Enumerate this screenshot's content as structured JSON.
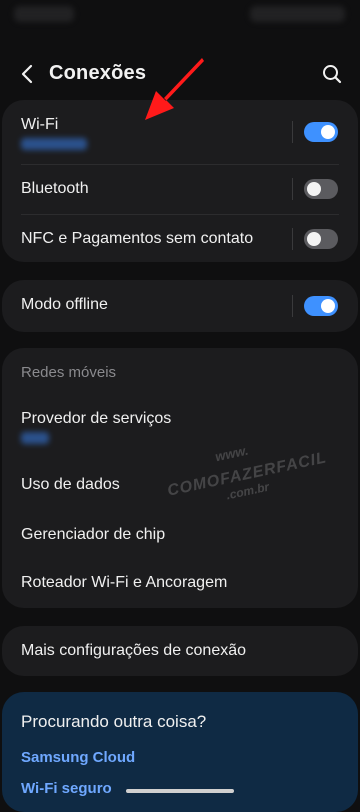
{
  "app_bar": {
    "title": "Conexões"
  },
  "connectivity": {
    "wifi": {
      "label": "Wi-Fi",
      "enabled": true
    },
    "bluetooth": {
      "label": "Bluetooth",
      "enabled": false
    },
    "nfc": {
      "label": "NFC e Pagamentos sem contato",
      "enabled": false
    }
  },
  "offline": {
    "label": "Modo offline",
    "enabled": true
  },
  "mobile": {
    "section_title": "Redes móveis",
    "items": [
      {
        "label": "Provedor de serviços"
      },
      {
        "label": "Uso de dados"
      },
      {
        "label": "Gerenciador de chip"
      },
      {
        "label": "Roteador Wi-Fi e Ancoragem"
      }
    ]
  },
  "more_settings": {
    "label": "Mais configurações de conexão"
  },
  "looking": {
    "title": "Procurando outra coisa?",
    "links": [
      "Samsung Cloud",
      "Wi-Fi seguro"
    ]
  },
  "watermark": {
    "line1": "www.",
    "line2": "COMOFAZERFACIL",
    "line3": ".com.br"
  },
  "colors": {
    "toggle_on": "#3e91ff",
    "link": "#6fa8ff",
    "arrow": "#ff1a1a"
  },
  "icons": {
    "back": "chevron-left-icon",
    "search": "search-icon",
    "annotation": "red-arrow"
  }
}
